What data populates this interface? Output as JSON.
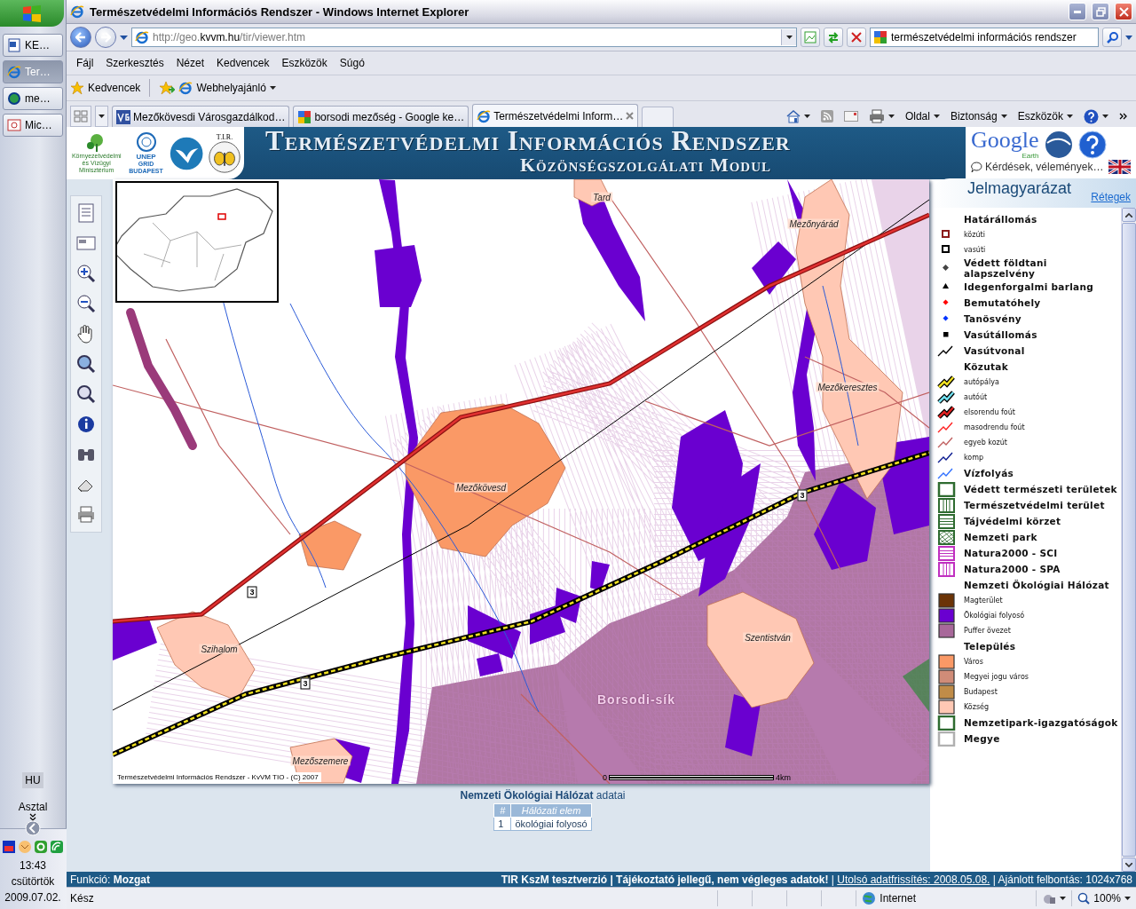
{
  "taskbar": {
    "buttons": [
      {
        "label": "KE…",
        "selected": false,
        "kind": "doc"
      },
      {
        "label": "Ter…",
        "selected": true,
        "kind": "ie"
      },
      {
        "label": "me…",
        "selected": false,
        "kind": "globe"
      },
      {
        "label": "Mic…",
        "selected": false,
        "kind": "slide"
      }
    ],
    "language": "HU",
    "desktop": "Asztal",
    "clock": {
      "time": "13:43",
      "day": "csütörtök",
      "date": "2009.07.02."
    }
  },
  "window": {
    "title": "Természetvédelmi Információs Rendszer - Windows Internet Explorer"
  },
  "address": {
    "prefix": "http://geo.",
    "domain": "kvvm.hu",
    "path": "/tir/viewer.htm"
  },
  "search": {
    "value": "természetvédelmi információs rendszer"
  },
  "menu": [
    "Fájl",
    "Szerkesztés",
    "Nézet",
    "Kedvencek",
    "Eszközök",
    "Súgó"
  ],
  "favorites": {
    "label": "Kedvencek",
    "suggested": "Webhelyajánló"
  },
  "tabs": [
    {
      "label": "Mezőkövesdi Városgazdálkod…",
      "selected": false,
      "kind": "vg"
    },
    {
      "label": "borsodi mezőség - Google ke…",
      "selected": false,
      "kind": "google"
    },
    {
      "label": "Természetvédelmi Inform…",
      "selected": true,
      "kind": "ie"
    }
  ],
  "command_bar": [
    "Oldal",
    "Biztonság",
    "Eszközök"
  ],
  "banner": {
    "title": "Természetvédelmi Információs Rendszer",
    "subtitle": "Közönségszolgálati Modul",
    "ministry": "Környezetvédelmi és Vízügyi Minisztérium",
    "unep": "UNEP",
    "grid": "GRID BUDAPEST",
    "tir": "T.I.R.",
    "google": "Google",
    "earth": "Earth",
    "feedback": "Kérdések, vélemények…"
  },
  "map": {
    "places": [
      "Tard",
      "Mezőnyárád",
      "Mezőkeresztes",
      "Mezőkövesd",
      "Szentistván",
      "Szihalom",
      "Mezőszemere"
    ],
    "road_numbers": [
      "3",
      "3",
      "3"
    ],
    "region": "Borsodi-sík",
    "scale": {
      "start": "0",
      "end": "4km"
    },
    "copyright": "Természetvédelmi Információs Rendszer - KvVM TIO - (C) 2007"
  },
  "legend": {
    "title": "Jelmagyarázat",
    "layers_link": "Rétegek",
    "items": [
      {
        "label": "Határállomás",
        "kind": "group",
        "children": [
          {
            "label": "közúti",
            "kind": "box",
            "color": "#8b1a1a"
          },
          {
            "label": "vasúti",
            "kind": "box",
            "color": "#000000"
          }
        ]
      },
      {
        "label": "Védett földtani alapszelvény",
        "kind": "diamond",
        "color": "#444444"
      },
      {
        "label": "Idegenforgalmi barlang",
        "kind": "triangle",
        "color": "#000000"
      },
      {
        "label": "Bemutatóhely",
        "kind": "dot",
        "color": "#ff0000"
      },
      {
        "label": "Tanösvény",
        "kind": "dot",
        "color": "#0033ff"
      },
      {
        "label": "Vasútállomás",
        "kind": "square",
        "color": "#000000"
      },
      {
        "label": "Vasútvonal",
        "kind": "line",
        "color": "#000000"
      },
      {
        "label": "Közutak",
        "kind": "group",
        "children": [
          {
            "label": "autópálya",
            "kind": "road",
            "color": "#f0e020"
          },
          {
            "label": "autóút",
            "kind": "road",
            "color": "#70e0f0"
          },
          {
            "label": "elsorendu foút",
            "kind": "road",
            "color": "#e02020"
          },
          {
            "label": "masodrendu foút",
            "kind": "line",
            "color": "#ff2020"
          },
          {
            "label": "egyeb kozút",
            "kind": "line",
            "color": "#c06060"
          },
          {
            "label": "komp",
            "kind": "line",
            "color": "#0a1a90"
          }
        ]
      },
      {
        "label": "Vízfolyás",
        "kind": "line",
        "color": "#3070ff"
      },
      {
        "label": "Védett természeti területek",
        "kind": "frame",
        "color": "#2e6b30"
      },
      {
        "label": "Természetvédelmi terület",
        "kind": "vstripes",
        "color": "#2e6b30"
      },
      {
        "label": "Tájvédelmi körzet",
        "kind": "hstripes",
        "color": "#2e6b30"
      },
      {
        "label": "Nemzeti park",
        "kind": "hatch",
        "color": "#2e6b30"
      },
      {
        "label": "Natura2000 - SCI",
        "kind": "hstripes",
        "color": "#c030c0"
      },
      {
        "label": "Natura2000 - SPA",
        "kind": "vstripes",
        "color": "#c030c0"
      },
      {
        "label": "Nemzeti Ökológiai Hálózat",
        "kind": "group",
        "children": [
          {
            "label": "Magterület",
            "kind": "fill",
            "color": "#6b3306"
          },
          {
            "label": "Ökológiai folyosó",
            "kind": "fill",
            "color": "#6a00d0"
          },
          {
            "label": "Puffer övezet",
            "kind": "fill",
            "color": "#a8689a"
          }
        ]
      },
      {
        "label": "Település",
        "kind": "group",
        "children": [
          {
            "label": "Város",
            "kind": "fill",
            "color": "#fa9966"
          },
          {
            "label": "Megyei jogu város",
            "kind": "fill",
            "color": "#d08c78"
          },
          {
            "label": "Budapest",
            "kind": "fill",
            "color": "#c08c48"
          },
          {
            "label": "Község",
            "kind": "fill",
            "color": "#ffc8b4"
          }
        ]
      },
      {
        "label": "Nemzetipark-igazgatóságok",
        "kind": "frame",
        "color": "#2e6b30"
      },
      {
        "label": "Megye",
        "kind": "frame",
        "color": "#b0b0b0"
      }
    ]
  },
  "data": {
    "heading": "**Nemzeti Ökológiai Hálózat** adatai",
    "columns": [
      "#",
      "Hálózati elem"
    ],
    "rows": [
      [
        "1",
        "ökológiai folyosó"
      ]
    ]
  },
  "function_bar": {
    "function": "Funkció: **Mozgat**",
    "notice": "**TIR KszM tesztverzió | Tájékoztató jellegű, nem végleges adatok!** |",
    "update_link": "Utolsó adatfrissítés: 2008.05.08.",
    "resolution": "| Ajánlott felbontás: 1024x768"
  },
  "status_bar": {
    "status": "Kész",
    "zone": "Internet",
    "zoom": "100%"
  }
}
